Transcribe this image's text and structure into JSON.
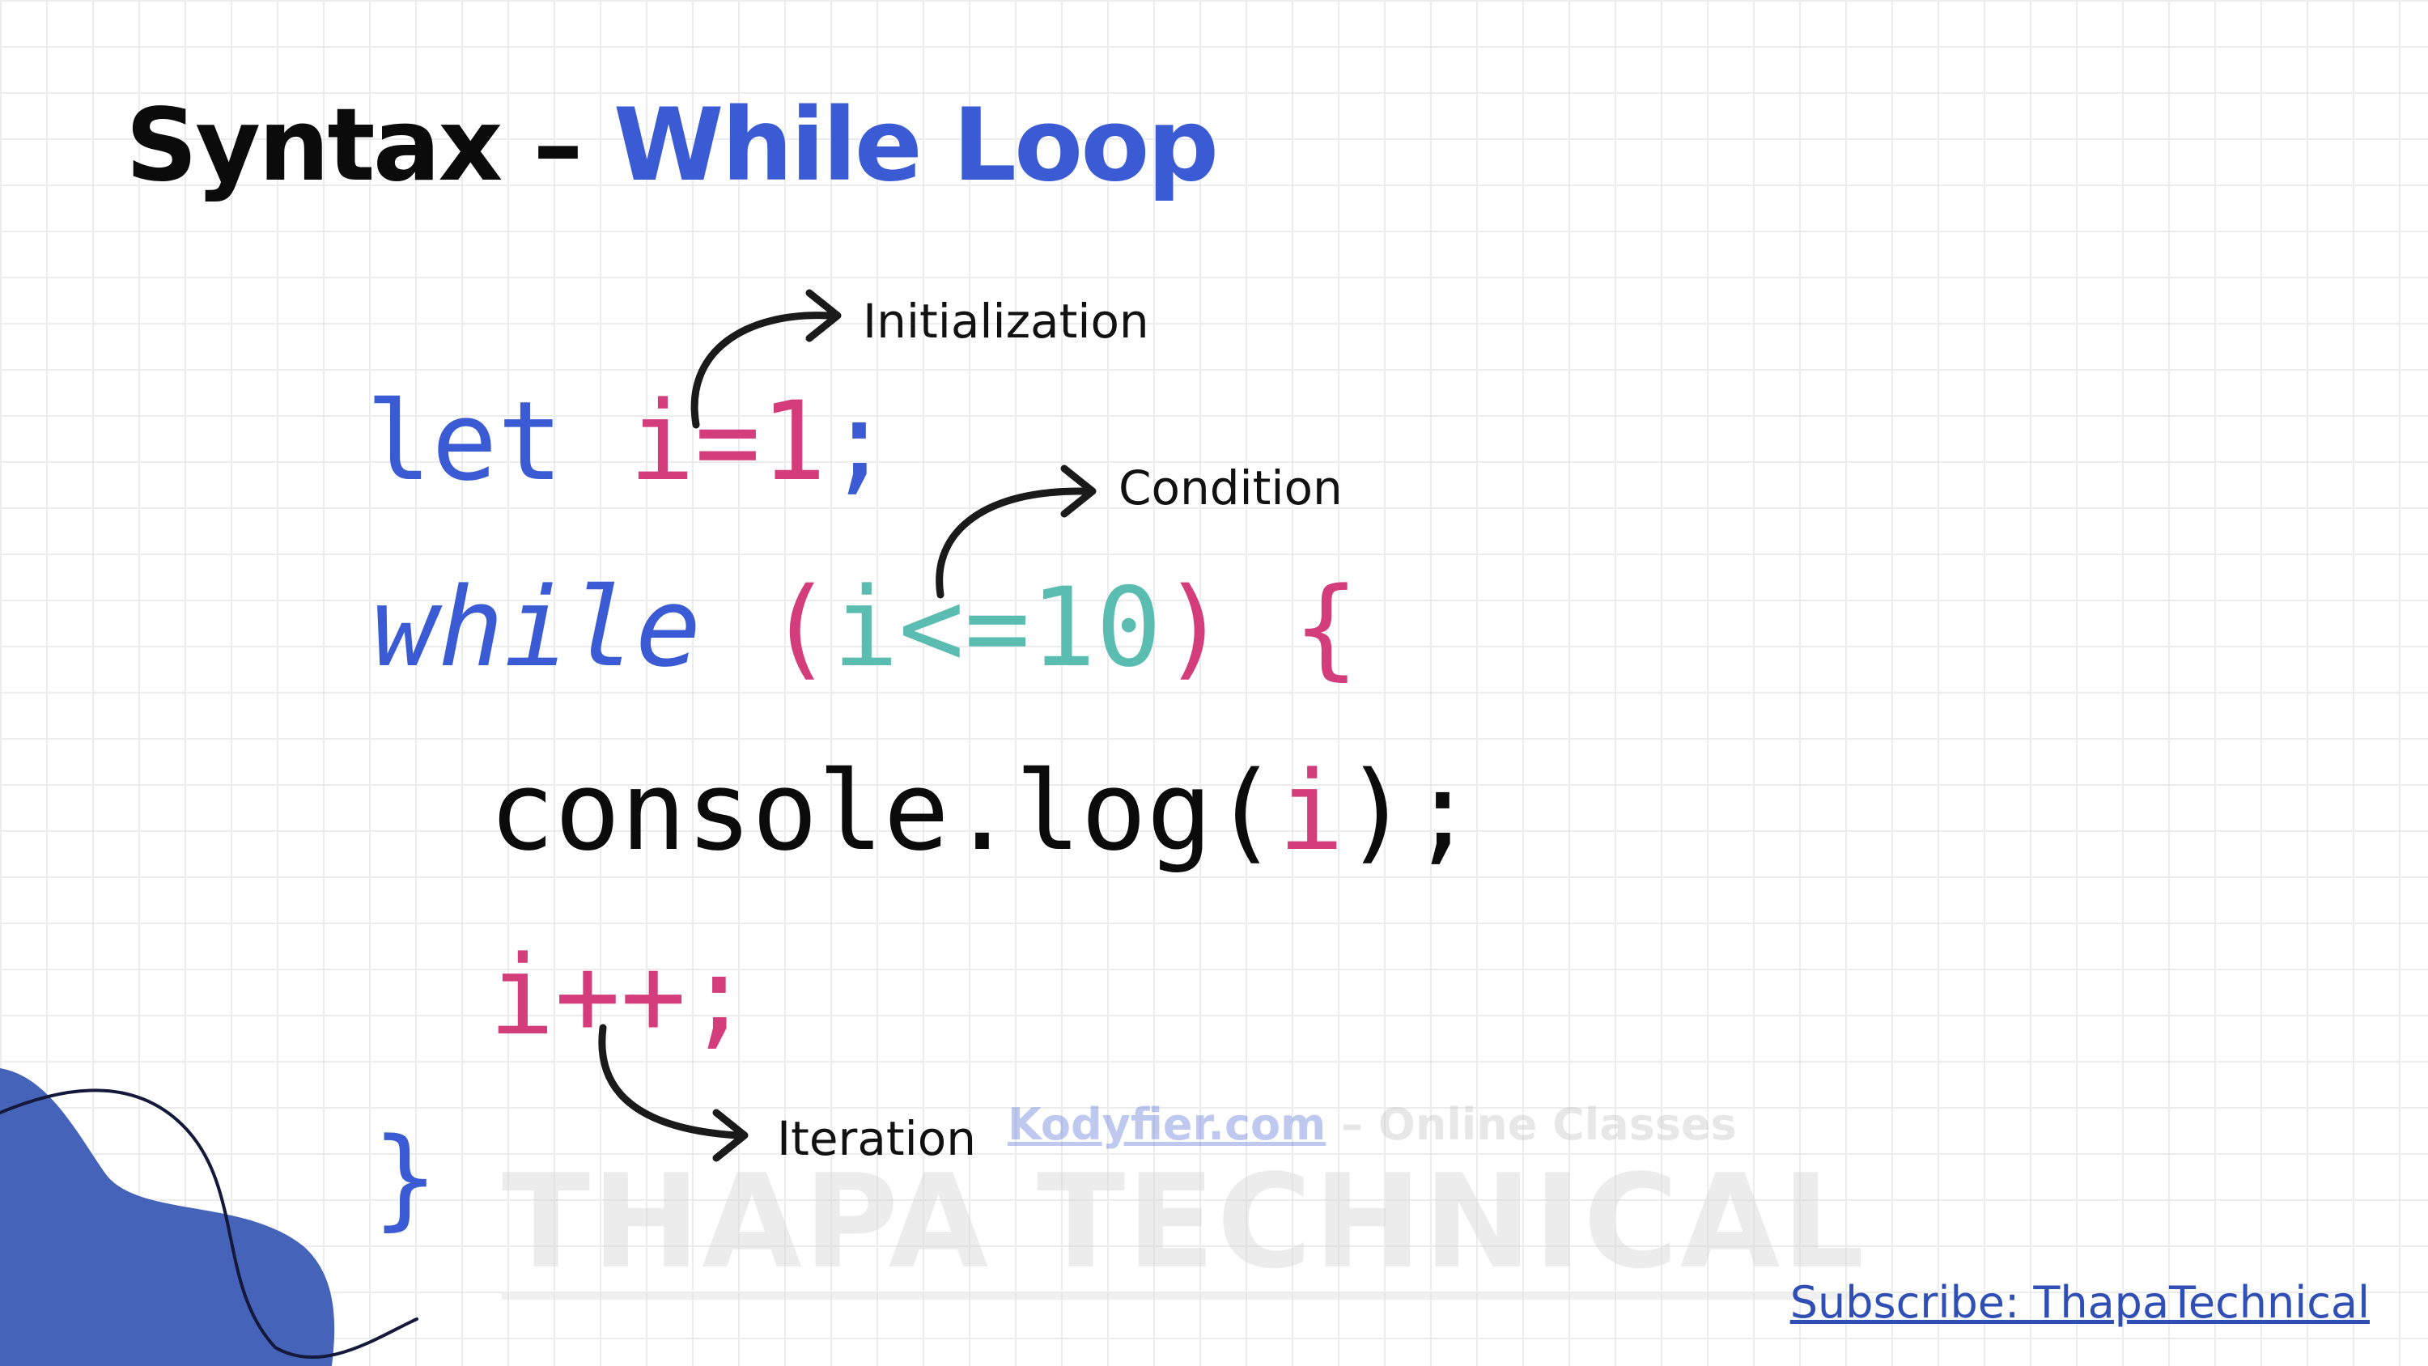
{
  "title": {
    "dark": "Syntax – ",
    "accent": "While Loop"
  },
  "code": {
    "line1": {
      "keyword": "let",
      "space": " ",
      "expr": "i=1",
      "end": ";"
    },
    "line2": {
      "keyword": "while",
      "space": " ",
      "open_paren": "(",
      "condition": "i<=10",
      "close_paren": ")",
      "space2": " ",
      "brace": "{"
    },
    "line3": {
      "call": "console.log(",
      "arg": "i",
      "end": ");"
    },
    "line4": {
      "expr": "i++;"
    },
    "line5": {
      "brace": "}"
    }
  },
  "annotations": {
    "initialization": "Initialization",
    "condition": "Condition",
    "iteration": "Iteration"
  },
  "watermark": {
    "site": "Kodyfier.com",
    "site_rest": " – Online Classes",
    "brand": "THAPA TECHNICAL"
  },
  "subscribe": "Subscribe: ThapaTechnical",
  "colors": {
    "keyword_blue": "#3a5bd3",
    "variable_pink": "#d33d7c",
    "condition_teal": "#5bbdb2",
    "blob_blue": "#4563b8",
    "link_blue": "#2f4fb4"
  }
}
